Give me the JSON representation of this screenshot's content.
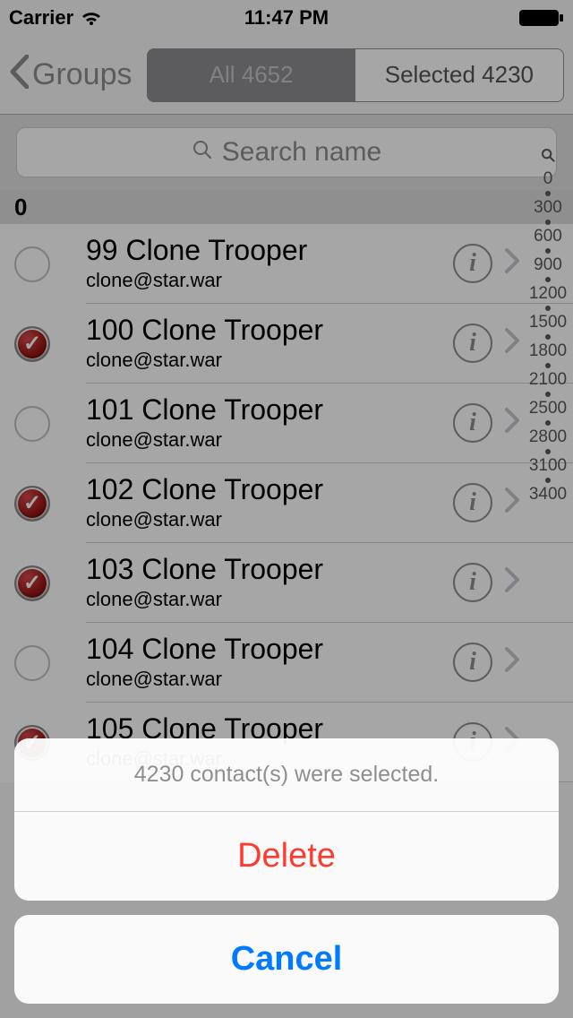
{
  "status": {
    "carrier": "Carrier",
    "time": "11:47 PM"
  },
  "nav": {
    "back_label": "Groups",
    "segment_all": "All 4652",
    "segment_selected": "Selected 4230"
  },
  "search": {
    "placeholder": "Search name"
  },
  "section_header": "0",
  "contacts": [
    {
      "name": "99 Clone Trooper",
      "email": "clone@star.war",
      "checked": false
    },
    {
      "name": "100 Clone Trooper",
      "email": "clone@star.war",
      "checked": true
    },
    {
      "name": "101 Clone Trooper",
      "email": "clone@star.war",
      "checked": false
    },
    {
      "name": "102 Clone Trooper",
      "email": "clone@star.war",
      "checked": true
    },
    {
      "name": "103 Clone Trooper",
      "email": "clone@star.war",
      "checked": true
    },
    {
      "name": "104 Clone Trooper",
      "email": "clone@star.war",
      "checked": false
    },
    {
      "name": "105 Clone Trooper",
      "email": "clone@star.war",
      "checked": true
    }
  ],
  "index": [
    "0",
    "300",
    "600",
    "900",
    "1200",
    "1500",
    "1800",
    "2100",
    "2500",
    "2800",
    "3100",
    "3400"
  ],
  "sheet": {
    "message": "4230 contact(s) were selected.",
    "delete": "Delete",
    "cancel": "Cancel"
  }
}
